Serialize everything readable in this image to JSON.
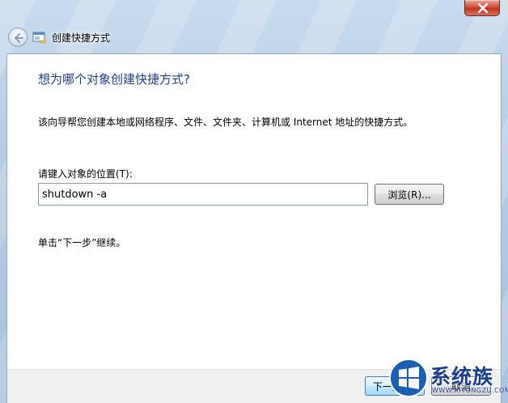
{
  "window": {
    "title": "创建快捷方式",
    "close_icon": "close-icon",
    "back_icon": "back-arrow-icon"
  },
  "page": {
    "heading": "想为哪个对象创建快捷方式?",
    "description": "该向导帮您创建本地或网络程序、文件、文件夹、计算机或 Internet 地址的快捷方式。",
    "location_label": "请键入对象的位置(T):",
    "location_value": "shutdown -a",
    "browse_label": "浏览(R)...",
    "hint": "单击“下一步”继续。"
  },
  "buttons": {
    "next_label": "下一步(N)",
    "cancel_label": "取消"
  },
  "watermark": {
    "text": "系统族",
    "url": "WWW.XITONGZU.COM"
  },
  "colors": {
    "heading": "#1e3d8f",
    "close_button": "#c2341f",
    "frame": "#b4cbe3"
  }
}
